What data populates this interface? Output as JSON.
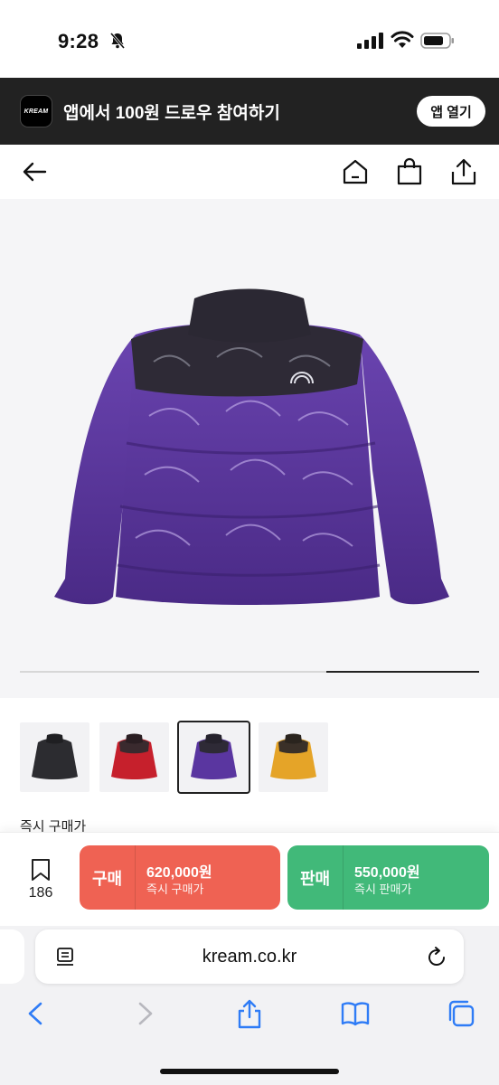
{
  "status_bar": {
    "time": "9:28"
  },
  "banner": {
    "logo_text": "KREAM",
    "promo_text": "앱에서 100원 드로우 참여하기",
    "open_app_label": "앱 열기"
  },
  "nav": {
    "icons": [
      "back-arrow-icon",
      "home-icon",
      "shopping-bag-icon",
      "share-icon"
    ]
  },
  "gallery": {
    "image_description": "purple and black printed puffer jacket, back view",
    "progress": 0.667
  },
  "thumbnails": [
    {
      "color": "black",
      "selected": false
    },
    {
      "color": "red",
      "selected": false
    },
    {
      "color": "purple",
      "selected": true
    },
    {
      "color": "yellow",
      "selected": false
    }
  ],
  "section": {
    "label": "즉시 구매가"
  },
  "action_bar": {
    "bookmark_count": "186",
    "buy": {
      "label": "구매",
      "price": "620,000원",
      "sub": "즉시 구매가",
      "color": "#ef6253"
    },
    "sell": {
      "label": "판매",
      "price": "550,000원",
      "sub": "즉시 판매가",
      "color": "#41b979"
    }
  },
  "browser": {
    "url": "kream.co.kr",
    "toolbar_icons": [
      "back-icon",
      "forward-icon",
      "share-icon",
      "bookmarks-icon",
      "tabs-icon"
    ]
  }
}
